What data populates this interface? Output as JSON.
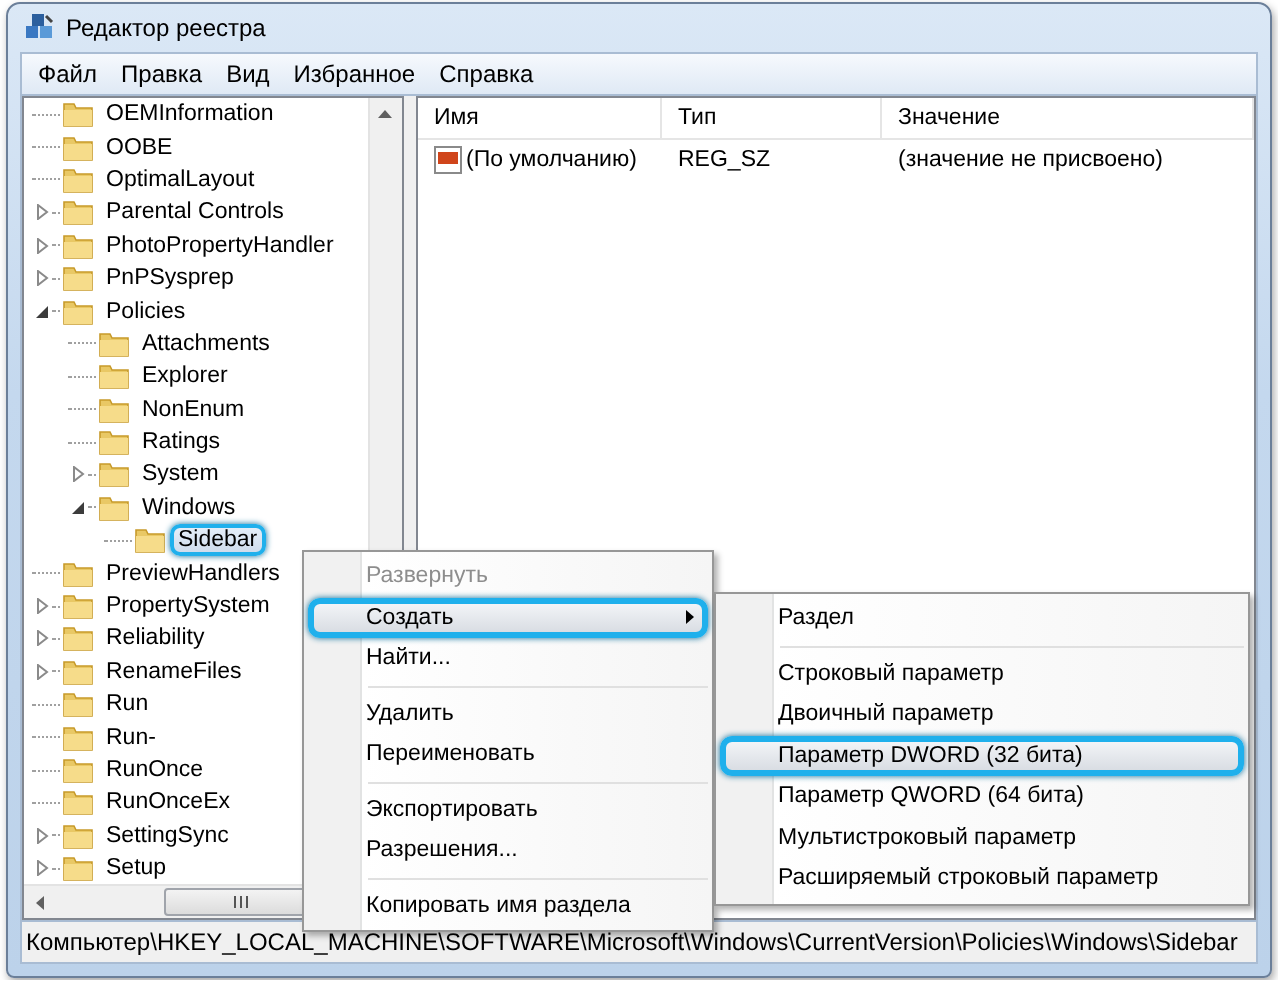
{
  "window": {
    "title": "Редактор реестра"
  },
  "menu_bar": [
    "Файл",
    "Правка",
    "Вид",
    "Избранное",
    "Справка"
  ],
  "tree": {
    "items": [
      {
        "label": "OEMInformation",
        "kind": "leaf",
        "expanded": false,
        "selected": false,
        "highlighted": false
      },
      {
        "label": "OOBE",
        "kind": "leaf",
        "expanded": false,
        "selected": false,
        "highlighted": false
      },
      {
        "label": "OptimalLayout",
        "kind": "leaf",
        "expanded": false,
        "selected": false,
        "highlighted": false
      },
      {
        "label": "Parental Controls",
        "kind": "branch",
        "expanded": false,
        "selected": false,
        "highlighted": false
      },
      {
        "label": "PhotoPropertyHandler",
        "kind": "branch",
        "expanded": false,
        "selected": false,
        "highlighted": false
      },
      {
        "label": "PnPSysprep",
        "kind": "branch",
        "expanded": false,
        "selected": false,
        "highlighted": false
      },
      {
        "label": "Policies",
        "kind": "branch",
        "expanded": true,
        "selected": false,
        "highlighted": false,
        "children": [
          {
            "label": "Attachments",
            "kind": "leaf",
            "expanded": false,
            "selected": false,
            "highlighted": false
          },
          {
            "label": "Explorer",
            "kind": "leaf",
            "expanded": false,
            "selected": false,
            "highlighted": false
          },
          {
            "label": "NonEnum",
            "kind": "leaf",
            "expanded": false,
            "selected": false,
            "highlighted": false
          },
          {
            "label": "Ratings",
            "kind": "leaf",
            "expanded": false,
            "selected": false,
            "highlighted": false
          },
          {
            "label": "System",
            "kind": "branch",
            "expanded": false,
            "selected": false,
            "highlighted": false
          },
          {
            "label": "Windows",
            "kind": "branch",
            "expanded": true,
            "selected": false,
            "highlighted": false,
            "children": [
              {
                "label": "Sidebar",
                "kind": "leaf",
                "expanded": false,
                "selected": true,
                "highlighted": true
              }
            ]
          }
        ]
      },
      {
        "label": "PreviewHandlers",
        "kind": "leaf",
        "expanded": false,
        "selected": false,
        "highlighted": false
      },
      {
        "label": "PropertySystem",
        "kind": "branch",
        "expanded": false,
        "selected": false,
        "highlighted": false
      },
      {
        "label": "Reliability",
        "kind": "branch",
        "expanded": false,
        "selected": false,
        "highlighted": false
      },
      {
        "label": "RenameFiles",
        "kind": "branch",
        "expanded": false,
        "selected": false,
        "highlighted": false
      },
      {
        "label": "Run",
        "kind": "leaf",
        "expanded": false,
        "selected": false,
        "highlighted": false
      },
      {
        "label": "Run-",
        "kind": "leaf",
        "expanded": false,
        "selected": false,
        "highlighted": false
      },
      {
        "label": "RunOnce",
        "kind": "leaf",
        "expanded": false,
        "selected": false,
        "highlighted": false
      },
      {
        "label": "RunOnceEx",
        "kind": "leaf",
        "expanded": false,
        "selected": false,
        "highlighted": false
      },
      {
        "label": "SettingSync",
        "kind": "branch",
        "expanded": false,
        "selected": false,
        "highlighted": false
      },
      {
        "label": "Setup",
        "kind": "branch",
        "expanded": false,
        "selected": false,
        "highlighted": false
      }
    ]
  },
  "table": {
    "columns": [
      "Имя",
      "Тип",
      "Значение"
    ],
    "rows": [
      {
        "name": "(По умолчанию)",
        "type": "REG_SZ",
        "value": "(значение не присвоено)"
      }
    ]
  },
  "context_menu": {
    "items": [
      {
        "kind": "item",
        "label": "Развернуть",
        "disabled": true,
        "has_submenu": false,
        "highlighted": false
      },
      {
        "kind": "item",
        "label": "Создать",
        "disabled": false,
        "has_submenu": true,
        "highlighted": true
      },
      {
        "kind": "item",
        "label": "Найти...",
        "disabled": false,
        "has_submenu": false,
        "highlighted": false
      },
      {
        "kind": "separator"
      },
      {
        "kind": "item",
        "label": "Удалить",
        "disabled": false,
        "has_submenu": false,
        "highlighted": false
      },
      {
        "kind": "item",
        "label": "Переименовать",
        "disabled": false,
        "has_submenu": false,
        "highlighted": false
      },
      {
        "kind": "separator"
      },
      {
        "kind": "item",
        "label": "Экспортировать",
        "disabled": false,
        "has_submenu": false,
        "highlighted": false
      },
      {
        "kind": "item",
        "label": "Разрешения...",
        "disabled": false,
        "has_submenu": false,
        "highlighted": false
      },
      {
        "kind": "separator"
      },
      {
        "kind": "item",
        "label": "Копировать имя раздела",
        "disabled": false,
        "has_submenu": false,
        "highlighted": false
      }
    ]
  },
  "submenu": {
    "items": [
      {
        "kind": "item",
        "label": "Раздел",
        "disabled": false,
        "has_submenu": false,
        "highlighted": false
      },
      {
        "kind": "separator"
      },
      {
        "kind": "item",
        "label": "Строковый параметр",
        "disabled": false,
        "has_submenu": false,
        "highlighted": false
      },
      {
        "kind": "item",
        "label": "Двоичный параметр",
        "disabled": false,
        "has_submenu": false,
        "highlighted": false
      },
      {
        "kind": "item",
        "label": "Параметр DWORD (32 бита)",
        "disabled": false,
        "has_submenu": false,
        "highlighted": true
      },
      {
        "kind": "item",
        "label": "Параметр QWORD (64 бита)",
        "disabled": false,
        "has_submenu": false,
        "highlighted": false
      },
      {
        "kind": "item",
        "label": "Мультистроковый параметр",
        "disabled": false,
        "has_submenu": false,
        "highlighted": false
      },
      {
        "kind": "item",
        "label": "Расширяемый строковый параметр",
        "disabled": false,
        "has_submenu": false,
        "highlighted": false
      }
    ]
  },
  "status_bar": "Компьютер\\HKEY_LOCAL_MACHINE\\SOFTWARE\\Microsoft\\Windows\\CurrentVersion\\Policies\\Windows\\Sidebar"
}
